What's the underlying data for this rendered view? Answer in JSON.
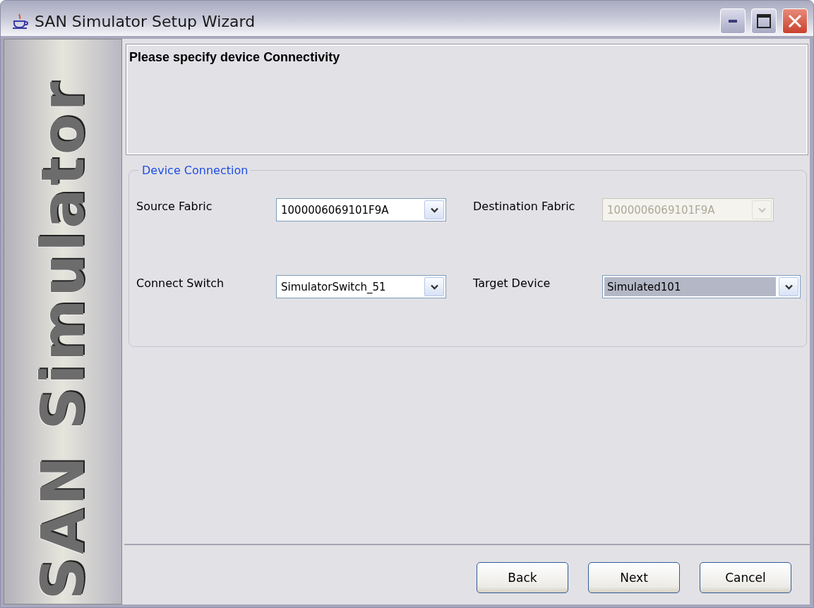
{
  "window": {
    "title": "SAN Simulator Setup Wizard"
  },
  "sidebar": {
    "logo_text": "SAN Simulator"
  },
  "header": {
    "heading": "Please specify device Connectivity"
  },
  "group": {
    "title": "Device Connection",
    "fields": [
      {
        "label": "Source Fabric",
        "value": "1000006069101F9A",
        "disabled": false,
        "highlighted": false
      },
      {
        "label": "Destination Fabric",
        "value": "1000006069101F9A",
        "disabled": true,
        "highlighted": false
      },
      {
        "label": "Connect Switch",
        "value": "SimulatorSwitch_51",
        "disabled": false,
        "highlighted": false
      },
      {
        "label": "Target Device",
        "value": "Simulated101",
        "disabled": false,
        "highlighted": true
      }
    ]
  },
  "buttons": [
    "Back",
    "Next",
    "Cancel"
  ]
}
